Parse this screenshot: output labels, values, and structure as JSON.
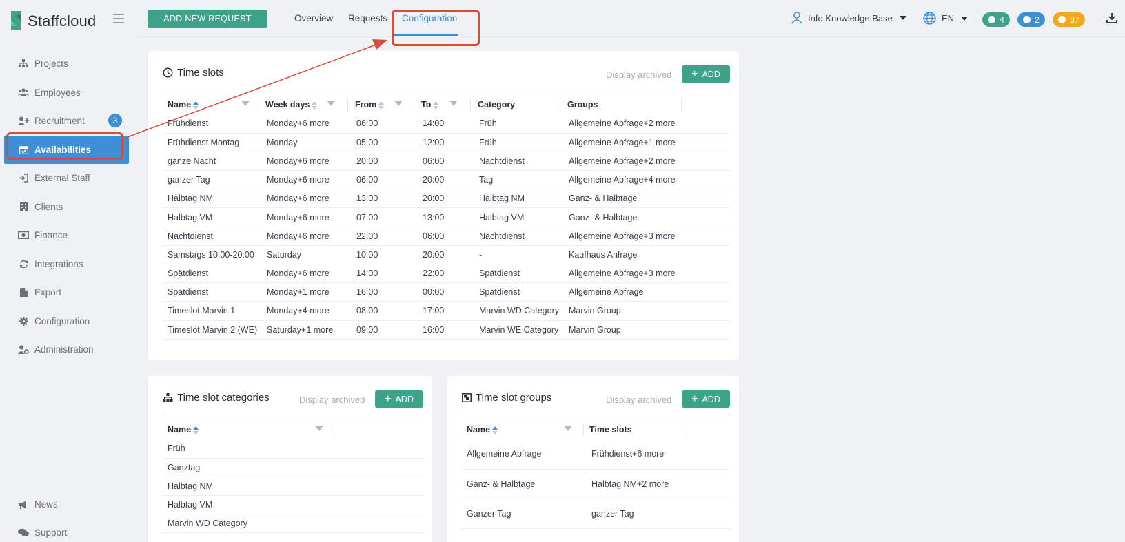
{
  "app": {
    "name": "Staffcloud"
  },
  "sidebar": {
    "items": [
      {
        "label": "Projects",
        "icon": "sitemap-icon"
      },
      {
        "label": "Employees",
        "icon": "users-icon"
      },
      {
        "label": "Recruitment",
        "icon": "user-plus-icon",
        "badge": "3"
      },
      {
        "label": "Availabilities",
        "icon": "calendar-check-icon",
        "active": true
      },
      {
        "label": "External Staff",
        "icon": "sign-in-icon"
      },
      {
        "label": "Clients",
        "icon": "building-icon"
      },
      {
        "label": "Finance",
        "icon": "money-icon"
      },
      {
        "label": "Integrations",
        "icon": "sync-icon"
      },
      {
        "label": "Export",
        "icon": "file-icon"
      },
      {
        "label": "Configuration",
        "icon": "gear-icon"
      },
      {
        "label": "Administration",
        "icon": "user-gear-icon"
      }
    ],
    "bottom": [
      {
        "label": "News",
        "icon": "megaphone-icon"
      },
      {
        "label": "Support",
        "icon": "comments-icon"
      }
    ]
  },
  "topbar": {
    "add_request": "ADD NEW REQUEST",
    "tabs": [
      "Overview",
      "Requests",
      "Configuration"
    ],
    "active_tab": "Configuration",
    "user": "Info Knowledge Base",
    "lang": "EN",
    "badges": [
      {
        "value": "4",
        "color": "#3ea389",
        "icon": "chat-icon"
      },
      {
        "value": "2",
        "color": "#3d8fd6",
        "icon": "bell-icon"
      },
      {
        "value": "37",
        "color": "#f5a623",
        "icon": "clock-icon"
      }
    ]
  },
  "time_slots": {
    "title": "Time slots",
    "display_archived": "Display archived",
    "add": "ADD",
    "columns": [
      "Name",
      "Week days",
      "From",
      "To",
      "Category",
      "Groups"
    ],
    "rows": [
      [
        "Frühdienst",
        "Monday+6 more",
        "06:00",
        "14:00",
        "Früh",
        "Allgemeine Abfrage+2 more"
      ],
      [
        "Frühdienst Montag",
        "Monday",
        "05:00",
        "12:00",
        "Früh",
        "Allgemeine Abfrage+1 more"
      ],
      [
        "ganze Nacht",
        "Monday+6 more",
        "20:00",
        "06:00",
        "Nachtdienst",
        "Allgemeine Abfrage+2 more"
      ],
      [
        "ganzer Tag",
        "Monday+6 more",
        "06:00",
        "20:00",
        "Tag",
        "Allgemeine Abfrage+4 more"
      ],
      [
        "Halbtag NM",
        "Monday+6 more",
        "13:00",
        "20:00",
        "Halbtag NM",
        "Ganz- & Halbtage"
      ],
      [
        "Halbtag VM",
        "Monday+6 more",
        "07:00",
        "13:00",
        "Halbtag VM",
        "Ganz- & Halbtage"
      ],
      [
        "Nachtdienst",
        "Monday+6 more",
        "22:00",
        "06:00",
        "Nachtdienst",
        "Allgemeine Abfrage+3 more"
      ],
      [
        "Samstags 10:00-20:00",
        "Saturday",
        "10:00",
        "20:00",
        "-",
        "Kaufhaus Anfrage"
      ],
      [
        "Spätdienst",
        "Monday+6 more",
        "14:00",
        "22:00",
        "Spätdienst",
        "Allgemeine Abfrage+3 more"
      ],
      [
        "Spätdienst",
        "Monday+1 more",
        "16:00",
        "00:00",
        "Spätdienst",
        "Allgemeine Abfrage"
      ],
      [
        "Timeslot Marvin 1",
        "Monday+4 more",
        "08:00",
        "17:00",
        "Marvin WD Category",
        "Marvin Group"
      ],
      [
        "Timeslot Marvin 2 (WE)",
        "Saturday+1 more",
        "09:00",
        "16:00",
        "Marvin WE Category",
        "Marvin Group"
      ]
    ]
  },
  "categories": {
    "title": "Time slot categories",
    "display_archived": "Display archived",
    "add": "ADD",
    "columns": [
      "Name"
    ],
    "rows": [
      "Früh",
      "Ganztag",
      "Halbtag NM",
      "Halbtag VM",
      "Marvin WD Category"
    ]
  },
  "groups": {
    "title": "Time slot groups",
    "display_archived": "Display archived",
    "add": "ADD",
    "columns": [
      "Name",
      "Time slots"
    ],
    "rows": [
      [
        "Allgemeine Abfrage",
        "Frühdienst+6 more"
      ],
      [
        "Ganz- & Halbtage",
        "Halbtag NM+2 more"
      ],
      [
        "Ganzer Tag",
        "ganzer Tag"
      ]
    ]
  }
}
